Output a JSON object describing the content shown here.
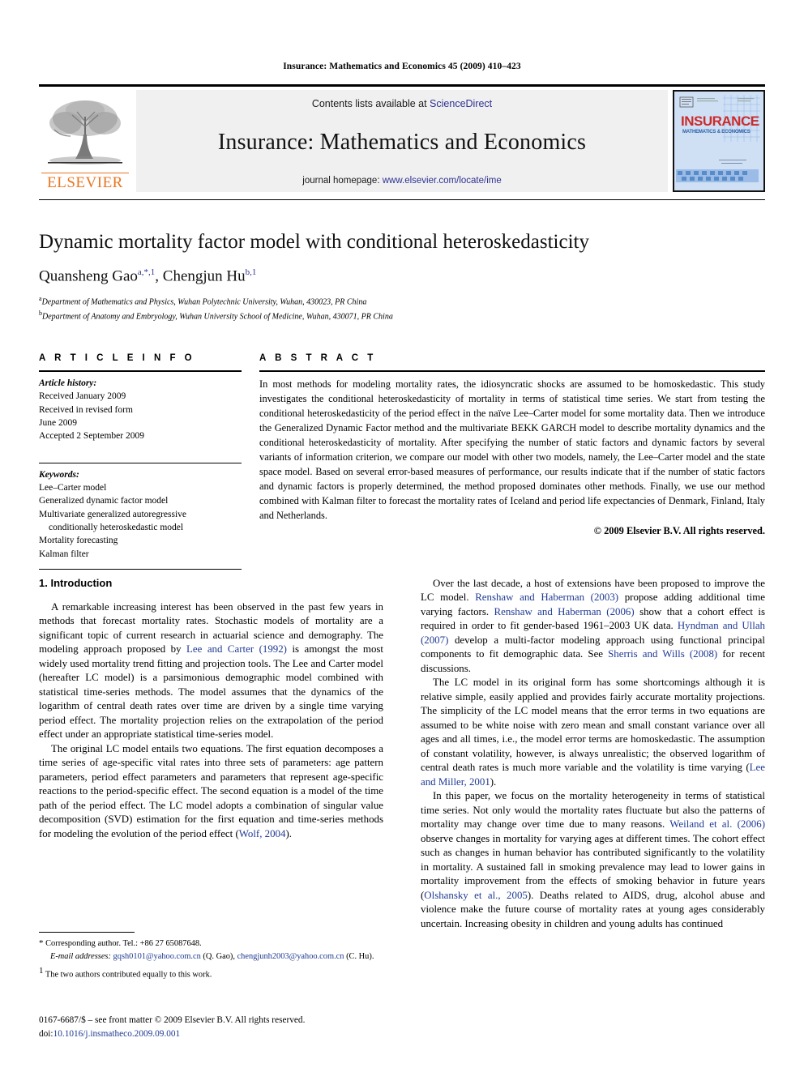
{
  "running_head": "Insurance: Mathematics and Economics 45 (2009) 410–423",
  "masthead": {
    "contents_prefix": "Contents lists available at ",
    "sciencedirect": "ScienceDirect",
    "journal_title": "Insurance: Mathematics and Economics",
    "homepage_prefix": "journal homepage: ",
    "homepage_url": "www.elsevier.com/locate/ime",
    "publisher": "ELSEVIER",
    "cover_title": "INSURANCE",
    "cover_subtitle": "MATHEMATICS & ECONOMICS",
    "link_color": "#2e3192",
    "publisher_color": "#e87722"
  },
  "title": "Dynamic mortality factor model with conditional heteroskedasticity",
  "authors": {
    "author1_name": "Quansheng Gao",
    "author1_marks": "a,*,1",
    "separator": ", ",
    "author2_name": "Chengjun Hu",
    "author2_marks": "b,1"
  },
  "affiliations": [
    {
      "mark": "a",
      "text": "Department of Mathematics and Physics, Wuhan Polytechnic University, Wuhan, 430023, PR China"
    },
    {
      "mark": "b",
      "text": "Department of Anatomy and Embryology, Wuhan University School of Medicine, Wuhan, 430071, PR China"
    }
  ],
  "article_info": {
    "heading": "A R T I C L E   I N F O",
    "history_label": "Article history:",
    "history_lines": [
      "Received January 2009",
      "Received in revised form",
      "June 2009",
      "Accepted 2 September 2009"
    ],
    "keywords_label": "Keywords:",
    "keywords": [
      "Lee–Carter model",
      "Generalized dynamic factor model",
      "Multivariate generalized autoregressive",
      "conditionally heteroskedastic model",
      "Mortality forecasting",
      "Kalman filter"
    ]
  },
  "abstract": {
    "heading": "A B S T R A C T",
    "text": "In most methods for modeling mortality rates, the idiosyncratic shocks are assumed to be homoskedastic. This study investigates the conditional heteroskedasticity of mortality in terms of statistical time series. We start from testing the conditional heteroskedasticity of the period effect in the naïve Lee–Carter model for some mortality data. Then we introduce the Generalized Dynamic Factor method and the multivariate BEKK GARCH model to describe mortality dynamics and the conditional heteroskedasticity of mortality. After specifying the number of static factors and dynamic factors by several variants of information criterion, we compare our model with other two models, namely, the Lee–Carter model and the state space model. Based on several error-based measures of performance, our results indicate that if the number of static factors and dynamic factors is properly determined, the method proposed dominates other methods. Finally, we use our method combined with Kalman filter to forecast the mortality rates of Iceland and period life expectancies of Denmark, Finland, Italy and Netherlands.",
    "copyright": "© 2009 Elsevier B.V. All rights reserved."
  },
  "body": {
    "section_title": "1. Introduction",
    "left_paragraphs": [
      "A remarkable increasing interest has been observed in the past few years in methods that forecast mortality rates. Stochastic models of mortality are a significant topic of current research in actuarial science and demography. The modeling approach proposed by Lee and Carter (1992) is amongst the most widely used mortality trend fitting and projection tools. The Lee and Carter model (hereafter LC model) is a parsimonious demographic model combined with statistical time-series methods. The model assumes that the dynamics of the logarithm of central death rates over time are driven by a single time varying period effect. The mortality projection relies on the extrapolation of the period effect under an appropriate statistical time-series model.",
      "The original LC model entails two equations. The first equation decomposes a time series of age-specific vital rates into three sets of parameters: age pattern parameters, period effect parameters and parameters that represent age-specific reactions to the period-specific effect. The second equation is a model of the time path of the period effect. The LC model adopts a combination of singular value decomposition (SVD) estimation for the first equation and time-series methods for modeling the evolution of the period effect (Wolf, 2004)."
    ],
    "right_paragraphs": [
      "Over the last decade, a host of extensions have been proposed to improve the LC model. Renshaw and Haberman (2003) propose adding additional time varying factors. Renshaw and Haberman (2006) show that a cohort effect is required in order to fit gender-based 1961–2003 UK data. Hyndman and Ullah (2007) develop a multi-factor modeling approach using functional principal components to fit demographic data. See Sherris and Wills (2008) for recent discussions.",
      "The LC model in its original form has some shortcomings although it is relative simple, easily applied and provides fairly accurate mortality projections. The simplicity of the LC model means that the error terms in two equations are assumed to be white noise with zero mean and small constant variance over all ages and all times, i.e., the model error terms are homoskedastic. The assumption of constant volatility, however, is always unrealistic; the observed logarithm of central death rates is much more variable and the volatility is time varying (Lee and Miller, 2001).",
      "In this paper, we focus on the mortality heterogeneity in terms of statistical time series. Not only would the mortality rates fluctuate but also the patterns of mortality may change over time due to many reasons. Weiland et al. (2006) observe changes in mortality for varying ages at different times. The cohort effect such as changes in human behavior has contributed significantly to the volatility in mortality. A sustained fall in smoking prevalence may lead to lower gains in mortality improvement from the effects of smoking behavior in future years (Olshansky et al., 2005). Deaths related to AIDS, drug, alcohol abuse and violence make the future course of mortality rates at young ages considerably uncertain. Increasing obesity in children and young adults has continued"
    ]
  },
  "footnotes": {
    "corresponding": "Corresponding author. Tel.: +86 27 65087648.",
    "corresponding_mark": "*",
    "email_label": "E-mail addresses:",
    "email1": "gqsh0101@yahoo.com.cn",
    "email1_attrib": "(Q. Gao),",
    "email2": "chengjunh2003@yahoo.com.cn",
    "email2_attrib": "(C. Hu).",
    "equal_mark": "1",
    "equal_text": "The two authors contributed equally to this work."
  },
  "imprint": {
    "issn_line": "0167-6687/$ – see front matter © 2009 Elsevier B.V. All rights reserved.",
    "doi_label": "doi:",
    "doi": "10.1016/j.insmatheco.2009.09.001"
  }
}
